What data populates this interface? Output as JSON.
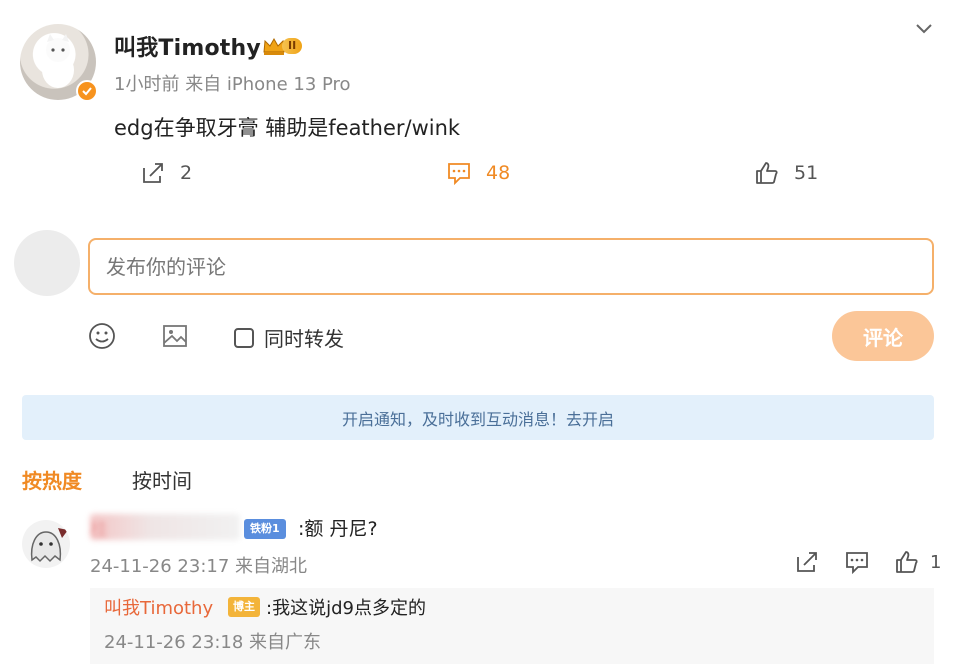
{
  "post": {
    "username": "叫我Timothy",
    "vip_level": "II",
    "time": "1小时前",
    "source": "来自 iPhone 13 Pro",
    "text": "edg在争取牙膏 辅助是feather/wink",
    "shares": "2",
    "comments": "48",
    "likes": "51"
  },
  "composer": {
    "placeholder": "发布你的评论",
    "repost_label": "同时转发",
    "submit_label": "评论"
  },
  "notice": {
    "text": "开启通知，及时收到互动消息！去开启"
  },
  "sort": {
    "hot_label": "按热度",
    "time_label": "按时间"
  },
  "comment": {
    "username_partial": "桂",
    "badge": "铁粉1",
    "text": ":额 丹尼?",
    "meta": "24-11-26 23:17 来自湖北",
    "likes": "1",
    "reply": {
      "username": "叫我Timothy",
      "badge": "博主",
      "text": ":我这说jd9点多定的",
      "meta": "24-11-26 23:18 来自广东"
    }
  },
  "colors": {
    "accent_orange": "#f08a24",
    "submit_bg": "#fbc698",
    "notice_bg": "#e3f0fb",
    "reply_name": "#e8683a"
  },
  "icons": {
    "share": "share-icon",
    "comment": "comment-icon",
    "like": "thumbs-up-icon",
    "emoji": "emoji-icon",
    "image": "image-icon",
    "chevron": "chevron-down-icon"
  }
}
